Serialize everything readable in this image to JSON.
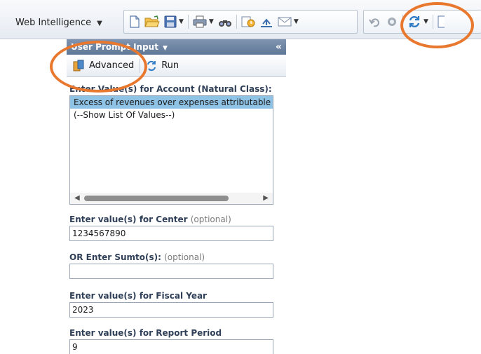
{
  "toolbar": {
    "app_menu_label": "Web Intelligence"
  },
  "panel": {
    "title": "User Prompt Input",
    "collapse_glyph": "«",
    "buttons": {
      "advanced_label": "Advanced",
      "run_label": "Run"
    }
  },
  "prompts": {
    "account": {
      "label": "Enter Value(s) for Account (Natural Class):",
      "items": [
        "Excess of revenues over expenses attributable to noncontrolling interest",
        "(--Show List Of Values--)"
      ],
      "selected_index": 0
    },
    "center": {
      "label": "Enter value(s) for Center",
      "optional": "(optional)",
      "value": "1234567890"
    },
    "sumto": {
      "label": "OR Enter Sumto(s):",
      "optional": "(optional)",
      "value": ""
    },
    "fiscal_year": {
      "label": "Enter value(s) for Fiscal Year",
      "value": "2023"
    },
    "report_period": {
      "label": "Enter value(s) for Report Period",
      "value": "9"
    }
  },
  "colors": {
    "highlight": "#e9782f",
    "selected_row": "#8fc3e6",
    "panel_header": "#6b83a3"
  },
  "icons": [
    "new-document-icon",
    "open-folder-icon",
    "save-icon",
    "print-icon",
    "find-icon",
    "track-changes-icon",
    "export-icon",
    "email-icon",
    "undo-icon",
    "redo-icon",
    "refresh-icon",
    "advanced-icon",
    "run-icon"
  ]
}
